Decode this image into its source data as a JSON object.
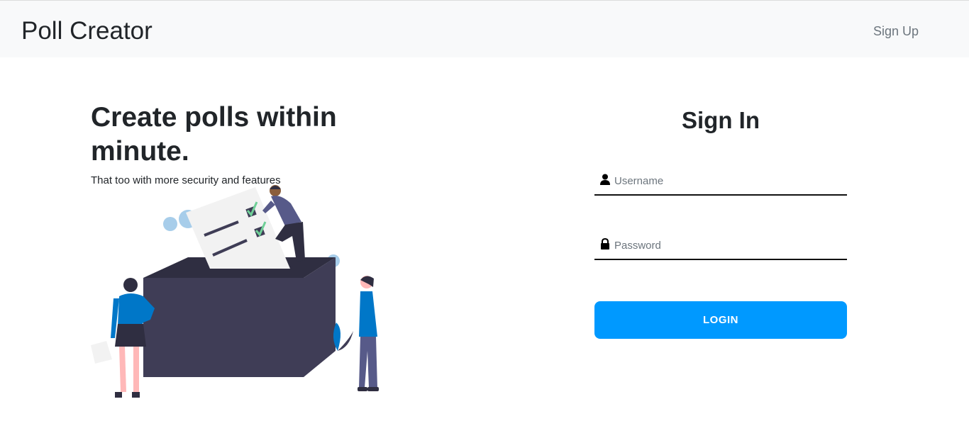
{
  "navbar": {
    "brand": "Poll Creator",
    "signup_link": "Sign Up"
  },
  "hero": {
    "title": "Create polls within minute.",
    "subtitle": "That too with more security and features"
  },
  "signin": {
    "title": "Sign In",
    "username": {
      "placeholder": "Username",
      "value": "",
      "icon": "user-icon"
    },
    "password": {
      "placeholder": "Password",
      "value": "",
      "icon": "lock-icon"
    },
    "login_label": "LOGIN"
  },
  "colors": {
    "navbar_bg": "#f8f9fa",
    "accent": "#0099ff",
    "ballot_box": "#3f3d56",
    "person_blue": "#0077c8"
  }
}
